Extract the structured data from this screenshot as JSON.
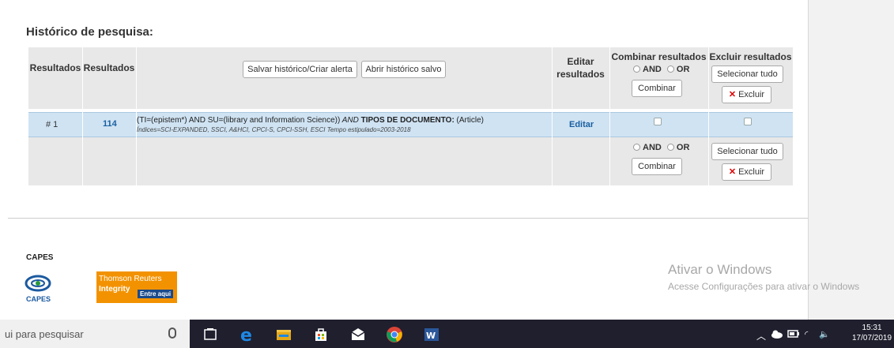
{
  "history": {
    "title": "Histórico de pesquisa:",
    "headers": {
      "col1": "Resultados",
      "col2": "Resultados",
      "save_button": "Salvar histórico/Criar alerta",
      "open_button": "Abrir histórico salvo",
      "edit": "Editar resultados",
      "combine": "Combinar resultados",
      "delete": "Excluir resultados"
    },
    "radio_and": "AND",
    "radio_or": "OR",
    "combine_button": "Combinar",
    "select_all_button": "Selecionar tudo",
    "delete_button": "Excluir",
    "rows": [
      {
        "set": "# 1",
        "count": "114",
        "query_main": "(TI=(epistem*) AND SU=(library and Information Science))",
        "query_and": " AND ",
        "query_type_label": "TIPOS DE DOCUMENTO:",
        "query_type_value": " (Article)",
        "query_sub": "Índices=SCI-EXPANDED, SSCI, A&HCI, CPCI-S, CPCI-SSH, ESCI Tempo estipulado=2003-2018",
        "edit_link": "Editar"
      }
    ]
  },
  "footer": {
    "capes_label": "CAPES",
    "capes_logo_text": "CAPES",
    "tr_line1": "Thomson Reuters",
    "tr_line2": "Integrity",
    "tr_line3": "Entre aqui"
  },
  "watermark": {
    "line1": "Ativar o Windows",
    "line2": "Acesse Configurações para ativar o Windows"
  },
  "taskbar": {
    "search_text": "ui para pesquisar",
    "time": "15:31",
    "date": "17/07/2019"
  }
}
